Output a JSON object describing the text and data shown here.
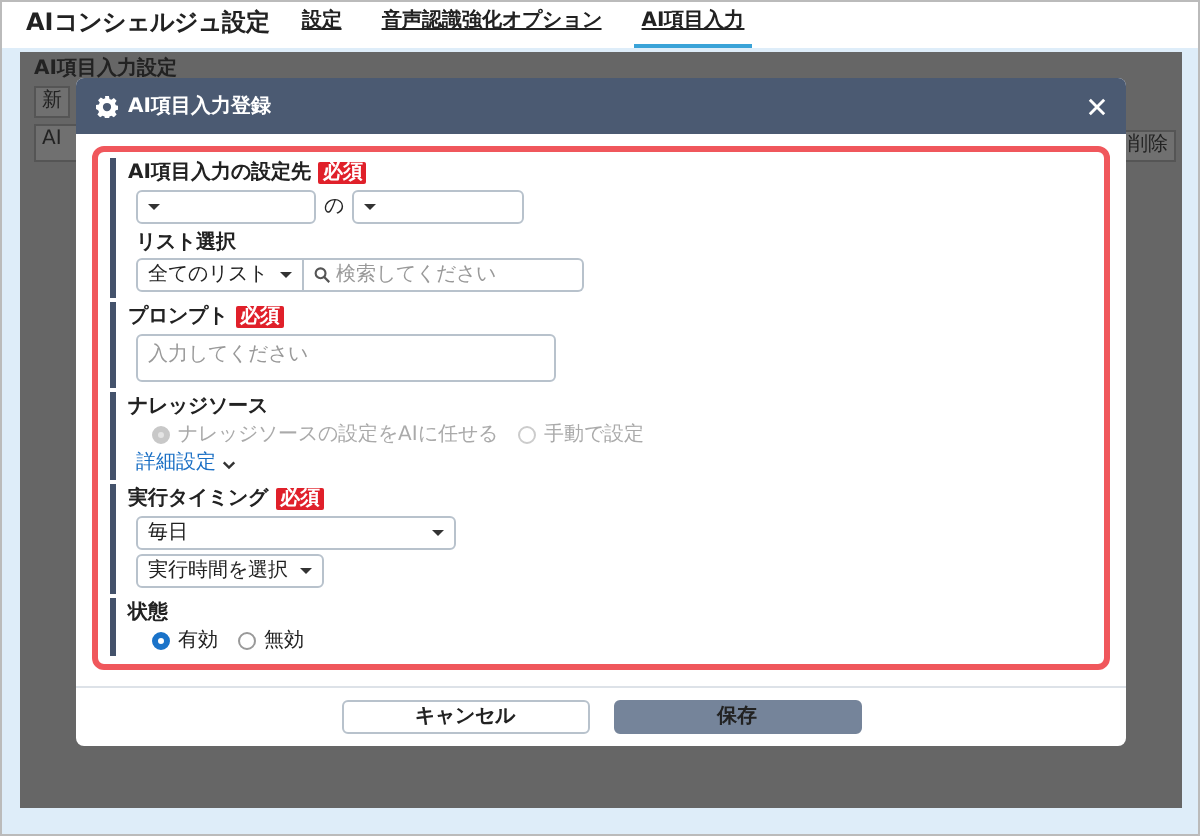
{
  "header": {
    "title": "AIコンシェルジュ設定",
    "tabs": [
      {
        "label": "設定",
        "selected": false
      },
      {
        "label": "音声認識強化オプション",
        "selected": false
      },
      {
        "label": "AI項目入力",
        "selected": true
      }
    ]
  },
  "background": {
    "heading": "AI項目入力設定",
    "new_button": "新",
    "field": "AI",
    "delete_button": "削除"
  },
  "modal": {
    "title": "AI項目入力登録",
    "sections": [
      {
        "label": "AI項目入力の設定先",
        "badge": "必須",
        "fields": [
          {
            "kind": "select_pair",
            "joiner": "の"
          },
          {
            "kind": "sublabel",
            "text": "リスト選択"
          },
          {
            "kind": "select_search",
            "value": "全てのリスト",
            "placeholder": "検索してください"
          }
        ]
      },
      {
        "label": "プロンプト",
        "badge": "必須",
        "fields": [
          {
            "kind": "textarea",
            "placeholder": "入力してください"
          }
        ]
      },
      {
        "label": "ナレッジソース",
        "fields": [
          {
            "kind": "radios",
            "disabled": true,
            "options": [
              {
                "label": "ナレッジソースの設定をAIに任せる",
                "selected": true
              },
              {
                "label": "手動で設定",
                "selected": false
              }
            ]
          },
          {
            "kind": "link",
            "text": "詳細設定"
          }
        ]
      },
      {
        "label": "実行タイミング",
        "badge": "必須",
        "fields": [
          {
            "kind": "select_wide",
            "value": "毎日"
          },
          {
            "kind": "select",
            "value": "実行時間を選択"
          }
        ]
      },
      {
        "label": "状態",
        "fields": [
          {
            "kind": "radios",
            "disabled": false,
            "options": [
              {
                "label": "有効",
                "selected": true
              },
              {
                "label": "無効",
                "selected": false
              }
            ]
          }
        ]
      }
    ],
    "buttons": [
      {
        "label": "キャンセル",
        "kind": "secondary"
      },
      {
        "label": "保存",
        "kind": "primary"
      }
    ]
  }
}
